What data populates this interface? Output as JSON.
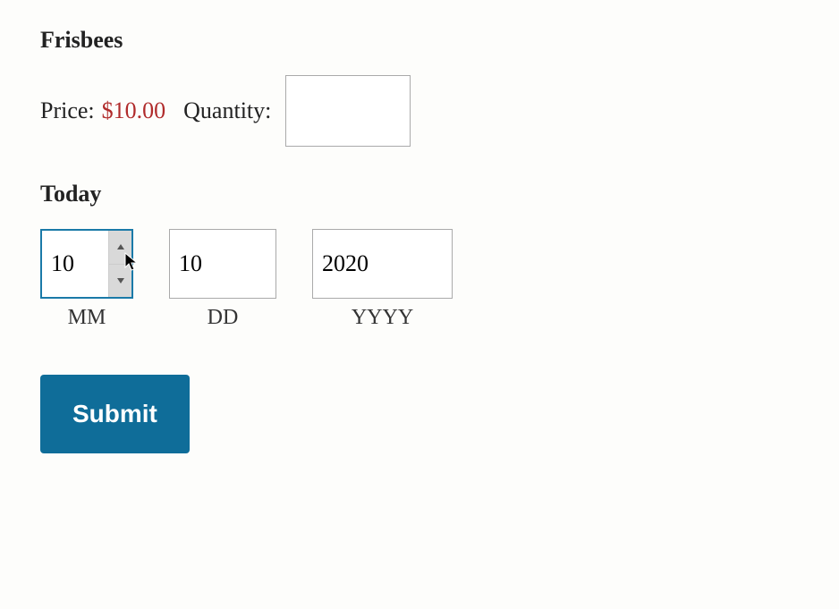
{
  "product": {
    "title": "Frisbees",
    "price_label": "Price:",
    "price_value": "$10.00",
    "quantity_label": "Quantity:",
    "quantity_value": ""
  },
  "date": {
    "heading": "Today",
    "mm": {
      "value": "10",
      "label": "MM"
    },
    "dd": {
      "value": "10",
      "label": "DD"
    },
    "yyyy": {
      "value": "2020",
      "label": "YYYY"
    }
  },
  "actions": {
    "submit": "Submit"
  }
}
